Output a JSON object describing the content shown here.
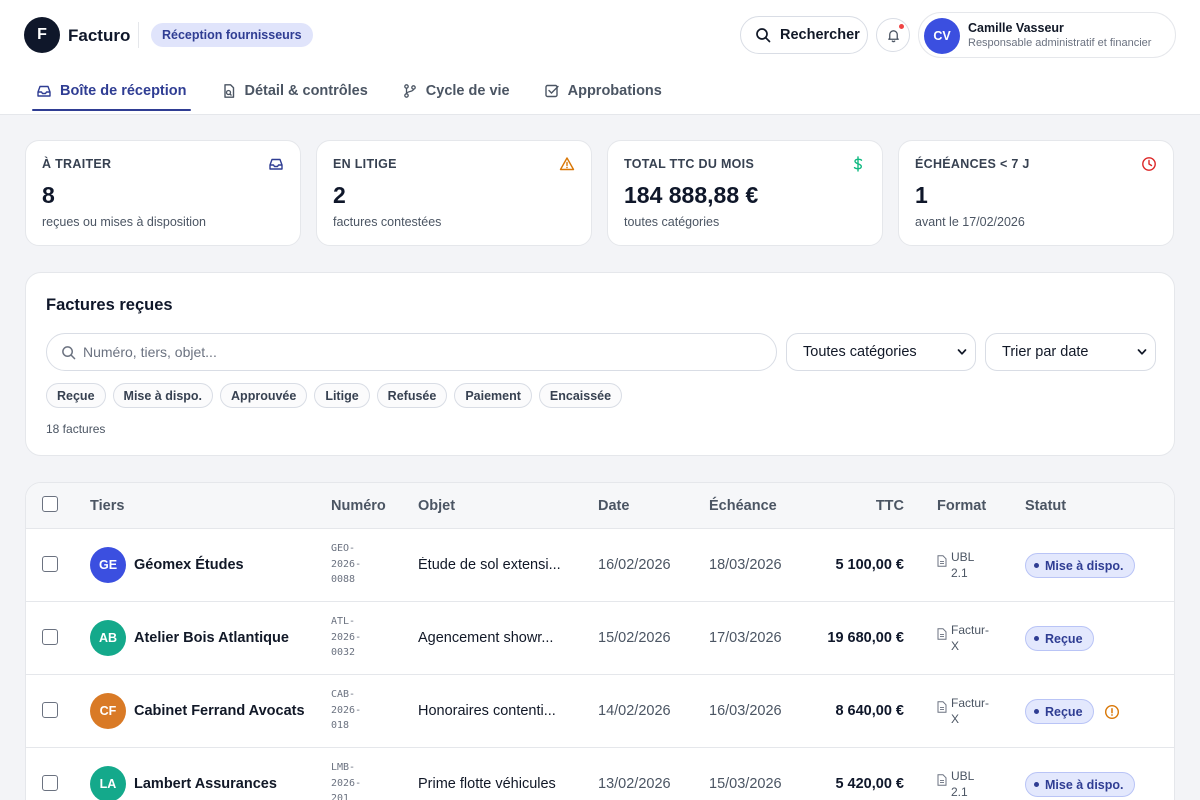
{
  "header": {
    "logo_letter": "F",
    "brand": "Facturo",
    "context_badge": "Réception fournisseurs",
    "search_label": "Rechercher",
    "user": {
      "initials": "CV",
      "name": "Camille Vasseur",
      "role": "Responsable administratif et financier"
    }
  },
  "tabs": [
    {
      "label": "Boîte de réception",
      "icon": "inbox-icon",
      "active": true
    },
    {
      "label": "Détail & contrôles",
      "icon": "document-icon",
      "active": false
    },
    {
      "label": "Cycle de vie",
      "icon": "branch-icon",
      "active": false
    },
    {
      "label": "Approbations",
      "icon": "checkbox-icon",
      "active": false
    }
  ],
  "kpis": [
    {
      "label": "À TRAITER",
      "value": "8",
      "sub": "reçues ou mises à disposition",
      "icon": "inbox-icon",
      "icon_color": "#2f3d93"
    },
    {
      "label": "EN LITIGE",
      "value": "2",
      "sub": "factures contestées",
      "icon": "warning-icon",
      "icon_color": "#d97706"
    },
    {
      "label": "TOTAL TTC DU MOIS",
      "value": "184 888,88 €",
      "sub": "toutes catégories",
      "icon": "dollar-icon",
      "icon_color": "#10b981"
    },
    {
      "label": "ÉCHÉANCES < 7 J",
      "value": "1",
      "sub": "avant le 17/02/2026",
      "icon": "clock-icon",
      "icon_color": "#dc2626"
    }
  ],
  "filters": {
    "title": "Factures reçues",
    "search_placeholder": "Numéro, tiers, objet...",
    "category_select": "Toutes catégories",
    "sort_select": "Trier par date",
    "chips": [
      "Reçue",
      "Mise à dispo.",
      "Approuvée",
      "Litige",
      "Refusée",
      "Paiement",
      "Encaissée"
    ],
    "count": "18 factures"
  },
  "table": {
    "columns": [
      "Tiers",
      "Numéro",
      "Objet",
      "Date",
      "Échéance",
      "TTC",
      "Format",
      "Statut"
    ],
    "rows": [
      {
        "initials": "GE",
        "avatar_color": "#3b4fe0",
        "tiers": "Géomex Études",
        "numero": "GEO-\n2026-\n0088",
        "objet": "Étude de sol extensi...",
        "date": "16/02/2026",
        "echeance": "18/03/2026",
        "ttc": "5 100,00 €",
        "format": "UBL\n2.1",
        "statut": "Mise à dispo.",
        "warning": false
      },
      {
        "initials": "AB",
        "avatar_color": "#14a98b",
        "tiers": "Atelier Bois Atlantique",
        "numero": "ATL-\n2026-\n0032",
        "objet": "Agencement showr...",
        "date": "15/02/2026",
        "echeance": "17/03/2026",
        "ttc": "19 680,00 €",
        "format": "Factur-\nX",
        "statut": "Reçue",
        "warning": false
      },
      {
        "initials": "CF",
        "avatar_color": "#d97a26",
        "tiers": "Cabinet Ferrand Avocats",
        "numero": "CAB-\n2026-\n018",
        "objet": "Honoraires contenti...",
        "date": "14/02/2026",
        "echeance": "16/03/2026",
        "ttc": "8 640,00 €",
        "format": "Factur-\nX",
        "statut": "Reçue",
        "warning": true
      },
      {
        "initials": "LA",
        "avatar_color": "#14a98b",
        "tiers": "Lambert Assurances",
        "numero": "LMB-\n2026-\n201",
        "objet": "Prime flotte véhicules",
        "date": "13/02/2026",
        "echeance": "15/03/2026",
        "ttc": "5 420,00 €",
        "format": "UBL\n2.1",
        "statut": "Mise à dispo.",
        "warning": false
      }
    ]
  }
}
